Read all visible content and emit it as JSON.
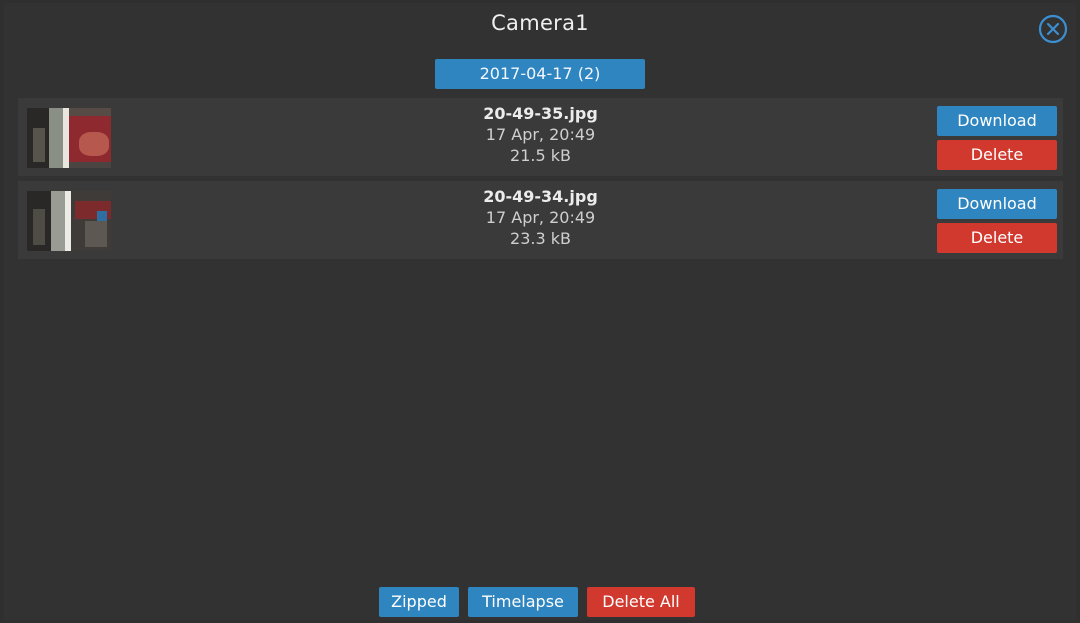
{
  "header": {
    "title": "Camera1",
    "close_icon": "close-circle-icon",
    "date_label": "2017-04-17 (2)"
  },
  "files": [
    {
      "name": "20-49-35.jpg",
      "date": "17 Apr, 20:49",
      "size": "21.5 kB",
      "download_label": "Download",
      "delete_label": "Delete"
    },
    {
      "name": "20-49-34.jpg",
      "date": "17 Apr, 20:49",
      "size": "23.3 kB",
      "download_label": "Download",
      "delete_label": "Delete"
    }
  ],
  "footer": {
    "zipped_label": "Zipped",
    "timelapse_label": "Timelapse",
    "delete_all_label": "Delete All"
  },
  "colors": {
    "background": "#323232",
    "row_background": "#3a3a3a",
    "accent_blue": "#2f85c0",
    "danger_red": "#d1382e"
  }
}
